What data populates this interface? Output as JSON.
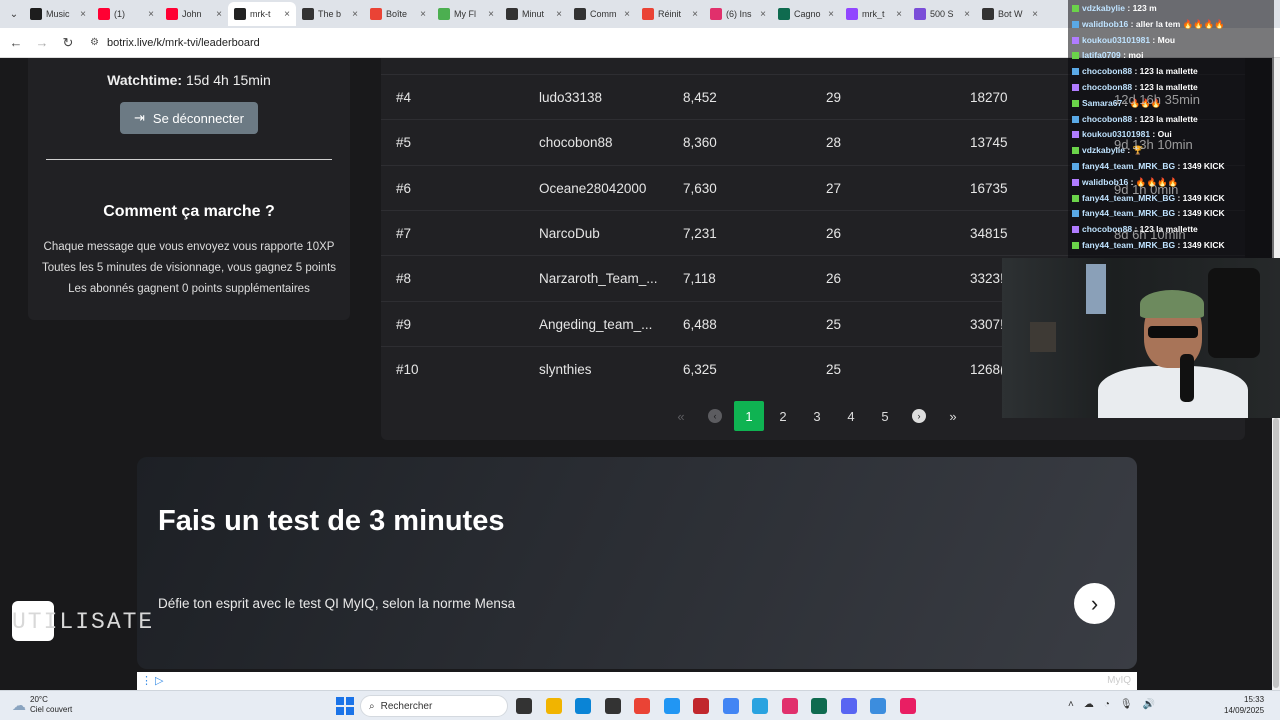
{
  "browser": {
    "tabs": [
      {
        "title": "Music",
        "color": "#1d1d1d"
      },
      {
        "title": "(1)",
        "color": "#ff0033"
      },
      {
        "title": "John",
        "color": "#ff0033"
      },
      {
        "title": "mrk-t",
        "color": "#222222"
      },
      {
        "title": "The b",
        "color": "#333333"
      },
      {
        "title": "Boîte",
        "color": "#ea4335"
      },
      {
        "title": "My Fl",
        "color": "#4caf50"
      },
      {
        "title": "Minut",
        "color": "#333333"
      },
      {
        "title": "Comm",
        "color": "#333333"
      },
      {
        "title": "Réinit",
        "color": "#ea4335"
      },
      {
        "title": "(6) Ins",
        "color": "#e1306c"
      },
      {
        "title": "Cagno",
        "color": "#0f6b4f"
      },
      {
        "title": "mrk_t",
        "color": "#9146ff"
      },
      {
        "title": "500 S",
        "color": "#7a4dd8"
      },
      {
        "title": "Bot W",
        "color": "#333333"
      }
    ],
    "url": "botrix.live/k/mrk-tvi/leaderboard"
  },
  "profile": {
    "watchtime_label": "Watchtime:",
    "watchtime_value": "15d 4h 15min",
    "logout_label": "Se déconnecter"
  },
  "how_it_works": {
    "title": "Comment ça marche ?",
    "lines": [
      "Chaque message que vous envoyez vous rapporte 10XP",
      "Toutes les 5 minutes de visionnage, vous gagnez 5 points",
      "Les abonnés gagnent 0 points supplémentaires"
    ]
  },
  "leaderboard": {
    "partial_top_row": {
      "name": "g",
      "points": "",
      "level": "",
      "xp": ""
    },
    "rows": [
      {
        "rank": "#4",
        "name": "ludo33138",
        "points": "8,452",
        "level": "29",
        "xp": "18270"
      },
      {
        "rank": "#5",
        "name": "chocobon88",
        "points": "8,360",
        "level": "28",
        "xp": "13745"
      },
      {
        "rank": "#6",
        "name": "Oceane28042000",
        "points": "7,630",
        "level": "27",
        "xp": "16735"
      },
      {
        "rank": "#7",
        "name": "NarcoDub",
        "points": "7,231",
        "level": "26",
        "xp": "34815"
      },
      {
        "rank": "#8",
        "name": "Narzaroth_Team_...",
        "points": "7,118",
        "level": "26",
        "xp": "3323!"
      },
      {
        "rank": "#9",
        "name": "Angeding_team_...",
        "points": "6,488",
        "level": "25",
        "xp": "3307!"
      },
      {
        "rank": "#10",
        "name": "slynthies",
        "points": "6,325",
        "level": "25",
        "xp": "1268("
      }
    ],
    "pagination": {
      "first": "«",
      "prev": "‹",
      "pages": [
        "1",
        "2",
        "3",
        "4",
        "5"
      ],
      "current": "1",
      "next": "›",
      "last": "»"
    }
  },
  "ad": {
    "title": "Fais un test de 3 minutes",
    "subtitle": "Défie ton esprit avec le test QI MyIQ, selon la norme Mensa",
    "next_icon": "chevron-right-icon",
    "brand": "MyIQ"
  },
  "watermark": "UTILISATE",
  "chat": [
    {
      "user": "vdzkabylie",
      "msg": ": 123 m"
    },
    {
      "user": "walidbob16",
      "msg": ": aller la tem 🔥🔥🔥🔥"
    },
    {
      "user": "koukou03101981",
      "msg": ": Mou"
    },
    {
      "user": "latifa0709",
      "msg": ": moi"
    },
    {
      "user": "chocobon88",
      "msg": ": 123 la mallette"
    },
    {
      "user": "chocobon88",
      "msg": ": 123 la mallette"
    },
    {
      "user": "Samara67",
      "msg": ": 🔥🔥🔥"
    },
    {
      "user": "chocobon88",
      "msg": ": 123 la mallette"
    },
    {
      "user": "koukou03101981",
      "msg": ": Oui"
    },
    {
      "user": "vdzkabylie",
      "msg": ": 🏆"
    },
    {
      "user": "fany44_team_MRK_BG",
      "msg": ": 1349 KICK"
    },
    {
      "user": "walidbob16",
      "msg": ": 🔥🔥🔥🔥"
    },
    {
      "user": "fany44_team_MRK_BG",
      "msg": ": 1349 KICK"
    },
    {
      "user": "fany44_team_MRK_BG",
      "msg": ": 1349 KICK"
    },
    {
      "user": "chocobon88",
      "msg": ": 123 la mallette"
    },
    {
      "user": "fany44_team_MRK_BG",
      "msg": ": 1349 KICK"
    }
  ],
  "ghost_watchtimes": [
    "12d 16h 35min",
    "9d 13h 10min",
    "9d 1h 0min",
    "8d 6h 10min"
  ],
  "taskbar": {
    "weather_temp": "20°C",
    "weather_desc": "Ciel couvert",
    "search_placeholder": "Rechercher",
    "time": "15:33",
    "date": "14/09/2025",
    "app_colors": [
      "#333333",
      "#f1b400",
      "#0a84d6",
      "#333333",
      "#ea4335",
      "#2196f3",
      "#c1272d",
      "#4285f4",
      "#2aa3e0",
      "#e1306c",
      "#0f6b4f",
      "#5865f2",
      "#3c8dde",
      "#e91e63"
    ]
  }
}
